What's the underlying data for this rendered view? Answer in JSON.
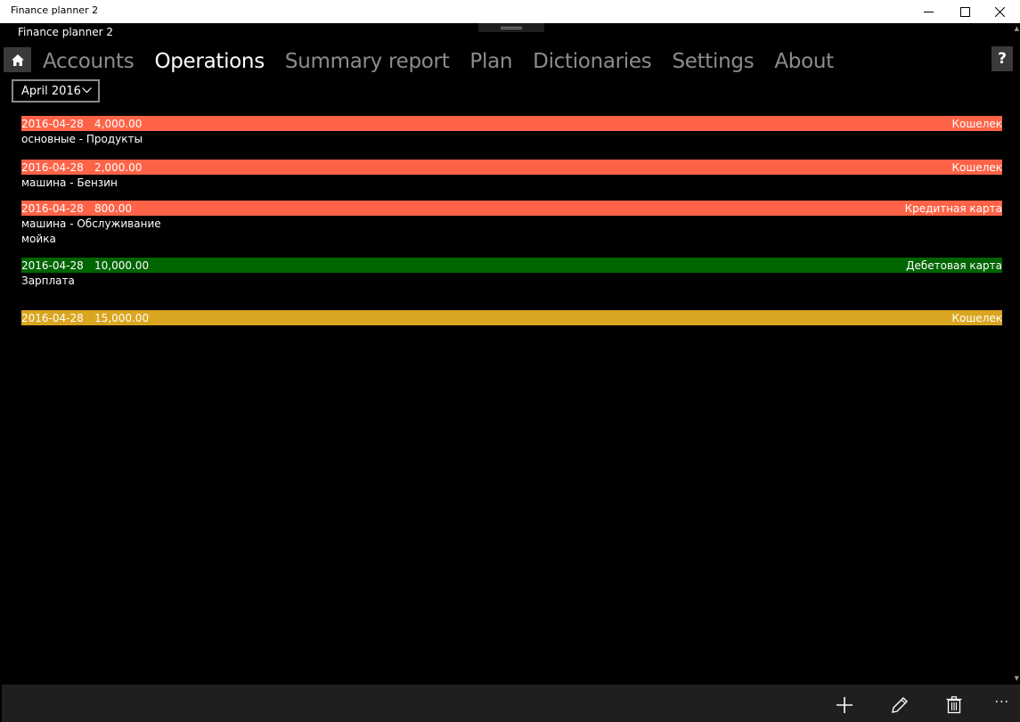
{
  "window": {
    "title": "Finance planner 2"
  },
  "app": {
    "title": "Finance planner 2"
  },
  "nav": {
    "tabs": [
      {
        "label": "Accounts",
        "active": false
      },
      {
        "label": "Operations",
        "active": true
      },
      {
        "label": "Summary report",
        "active": false
      },
      {
        "label": "Plan",
        "active": false
      },
      {
        "label": "Dictionaries",
        "active": false
      },
      {
        "label": "Settings",
        "active": false
      },
      {
        "label": "About",
        "active": false
      }
    ],
    "help_label": "?"
  },
  "month_select": {
    "value": "April 2016"
  },
  "operations": [
    {
      "date": "2016-04-28",
      "amount": "4,000.00",
      "account": "Кошелек",
      "color": "#ff6347",
      "lines": [
        "основные - Продукты"
      ]
    },
    {
      "date": "2016-04-28",
      "amount": "2,000.00",
      "account": "Кошелек",
      "color": "#ff6347",
      "lines": [
        "машина - Бензин"
      ]
    },
    {
      "date": "2016-04-28",
      "amount": "800.00",
      "account": "Кредитная карта",
      "color": "#ff6347",
      "lines": [
        "машина - Обслуживание",
        "мойка"
      ]
    },
    {
      "date": "2016-04-28",
      "amount": "10,000.00",
      "account": "Дебетовая карта",
      "color": "#006400",
      "lines": [
        "Зарплата"
      ]
    },
    {
      "date": "2016-04-28",
      "amount": "15,000.00",
      "account": "Кошелек",
      "color": "#daa520",
      "lines": []
    }
  ],
  "command_bar": {
    "more_label": "···"
  },
  "icons": {
    "home": "home-icon",
    "add": "add-icon",
    "edit": "pencil-icon",
    "delete": "trash-icon",
    "minimize": "minimize-icon",
    "maximize": "maximize-icon",
    "close": "close-icon"
  }
}
